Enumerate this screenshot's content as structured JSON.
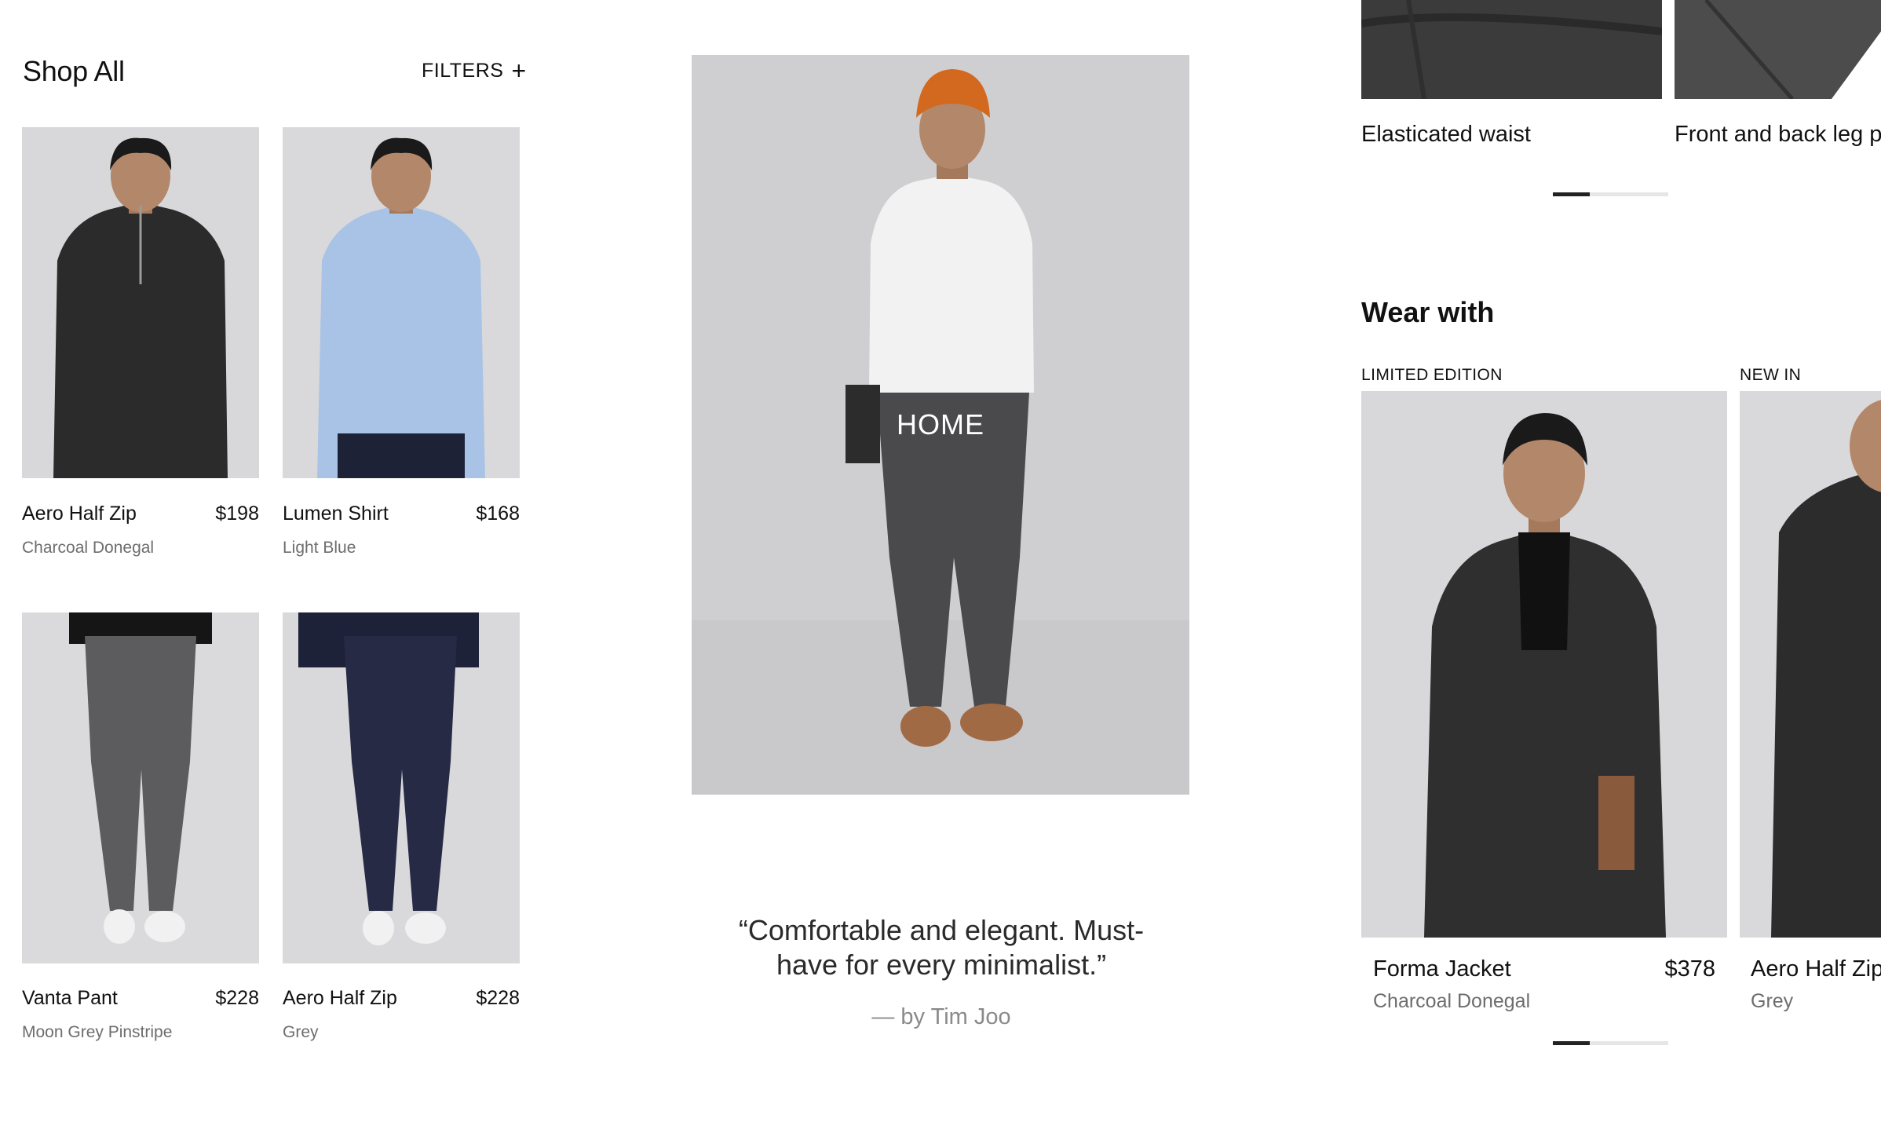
{
  "shop": {
    "title": "Shop All",
    "filters_label": "FILTERS",
    "filters_icon": "plus-icon",
    "products": [
      {
        "name": "Aero Half Zip",
        "price": "$198",
        "variant": "Charcoal Donegal"
      },
      {
        "name": "Lumen Shirt",
        "price": "$168",
        "variant": "Light Blue"
      },
      {
        "name": "Vanta Pant",
        "price": "$228",
        "variant": "Moon Grey Pinstripe"
      },
      {
        "name": "Aero Half Zip",
        "price": "$228",
        "variant": "Grey"
      }
    ]
  },
  "feature": {
    "label": "HOME",
    "quote_line1": "“Comfortable and elegant. Must-",
    "quote_line2": "have for every minimalist.”",
    "author": "— by Tim Joo"
  },
  "details": {
    "captions": [
      "Elasticated waist",
      "Front and back leg pi"
    ]
  },
  "wear_with": {
    "title": "Wear with",
    "items": [
      {
        "tag": "LIMITED EDITION",
        "name": "Forma Jacket",
        "price": "$378",
        "variant": "Charcoal Donegal"
      },
      {
        "tag": "NEW IN",
        "name": "Aero Half Zip",
        "price": "",
        "variant": "Grey"
      }
    ]
  },
  "colors": {
    "background": "#ffffff",
    "text": "#111111",
    "muted": "#6d6d6d",
    "photo_bg": "#d9d9db",
    "pager_active": "#222222",
    "pager_track": "#e6e6e6"
  }
}
